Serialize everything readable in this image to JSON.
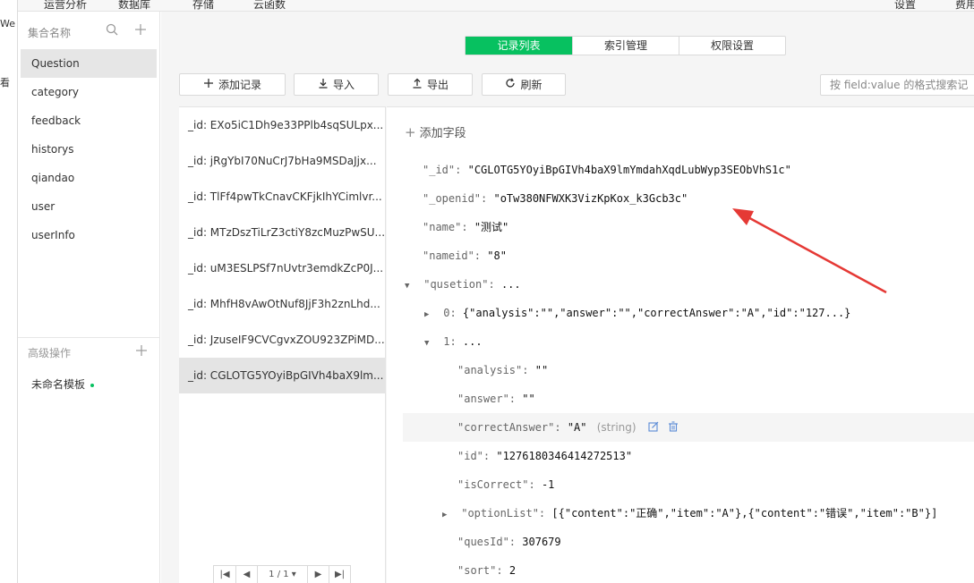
{
  "top_menu": {
    "items": [
      "运营分析",
      "数据库",
      "存储",
      "云函数",
      "设置",
      "费用"
    ],
    "edge_texts": [
      "We",
      "看"
    ]
  },
  "sidebar": {
    "title": "集合名称",
    "collections": [
      "Question",
      "category",
      "feedback",
      "historys",
      "qiandao",
      "user",
      "userInfo"
    ],
    "active_collection": "Question",
    "advanced_title": "高级操作",
    "template_name": "未命名模板"
  },
  "tabs": [
    {
      "label": "记录列表",
      "active": true
    },
    {
      "label": "索引管理",
      "active": false
    },
    {
      "label": "权限设置",
      "active": false
    }
  ],
  "toolbar": {
    "add_record": "添加记录",
    "import": "导入",
    "export": "导出",
    "refresh": "刷新",
    "search_placeholder": "按 field:value 的格式搜索记"
  },
  "documents": [
    "_id: EXo5iC1Dh9e33PPlb4sqSULpx...",
    "_id: jRgYbI70NuCrJ7bHa9MSDaJjx...",
    "_id: TlFf4pwTkCnavCKFjkIhYCimlvr...",
    "_id: MTzDszTiLrZ3ctiY8zcMuzPwSU...",
    "_id: uM3ESLPSf7nUvtr3emdkZcP0J...",
    "_id: MhfH8vAwOtNuf8JjF3h2znLhd...",
    "_id: JzuseIF9CVCgvxZOU923ZPiMD...",
    "_id: CGLOTG5YOyiBpGIVh4baX9lm..."
  ],
  "active_document_index": 7,
  "pager": {
    "first": "|◀",
    "prev": "◀",
    "page": "1 / 1 ▾",
    "next": "▶",
    "last": "▶|"
  },
  "detail": {
    "add_field": "添加字段",
    "fields": {
      "id_key": "\"_id\":",
      "id_val": "\"CGLOTG5YOyiBpGIVh4baX9lmYmdahXqdLubWyp3SEObVhS1c\"",
      "openid_key": "\"_openid\":",
      "openid_val": "\"oTw380NFWXK3VizKpKox_k3Gcb3c\"",
      "name_key": "\"name\":",
      "name_val": "\"测试\"",
      "nameid_key": "\"nameid\":",
      "nameid_val": "\"8\"",
      "qusetion_key": "\"qusetion\":",
      "qusetion_val": "...",
      "q0_key": "0:",
      "q0_val": "{\"analysis\":\"\",\"answer\":\"\",\"correctAnswer\":\"A\",\"id\":\"127...}",
      "q1_key": "1:",
      "q1_val": "...",
      "analysis_key": "\"analysis\":",
      "analysis_val": "\"\"",
      "answer_key": "\"answer\":",
      "answer_val": "\"\"",
      "correct_key": "\"correctAnswer\":",
      "correct_val": "\"A\"",
      "correct_type": "(string)",
      "qid_key": "\"id\":",
      "qid_val": "\"1276180346414272513\"",
      "iscorrect_key": "\"isCorrect\":",
      "iscorrect_val": "-1",
      "optionlist_key": "\"optionList\":",
      "optionlist_val": "[{\"content\":\"正确\",\"item\":\"A\"},{\"content\":\"错误\",\"item\":\"B\"}]",
      "quesid_key": "\"quesId\":",
      "quesid_val": "307679",
      "sort_key": "\"sort\":",
      "sort_val": "2"
    }
  },
  "colors": {
    "accent": "#07c160",
    "annotation_arrow": "#e53935"
  }
}
